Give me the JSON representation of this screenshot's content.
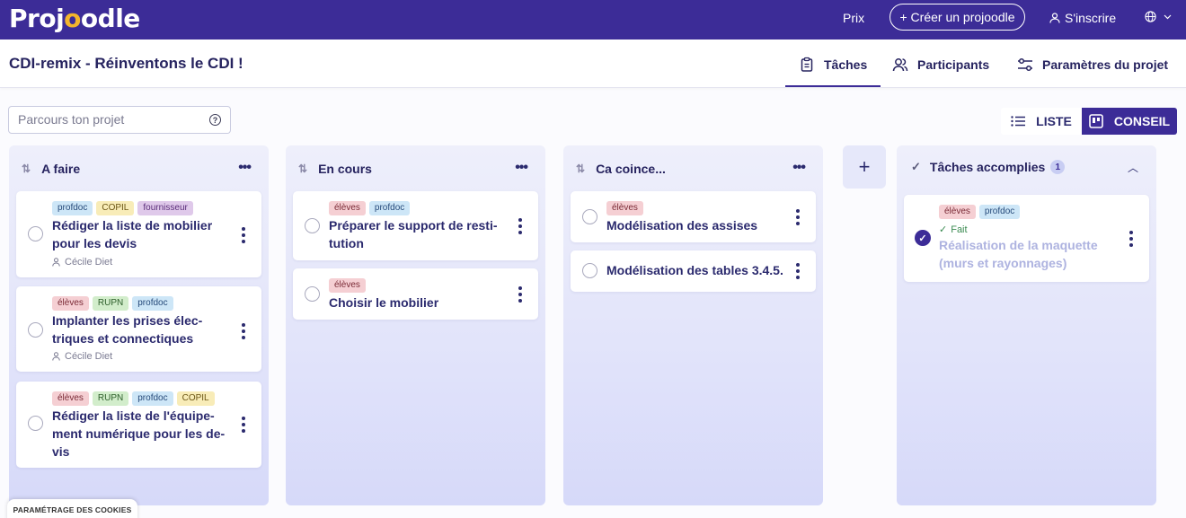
{
  "topbar": {
    "logo_left": "Proj",
    "logo_o": "o",
    "logo_right": "odle",
    "prix": "Prix",
    "create": "+ Créer un projoodle",
    "signin": "S'inscrire",
    "lang_icon": "globe-icon"
  },
  "project": {
    "title": "CDI-remix - Réinventons le CDI !",
    "tabs": [
      {
        "label": "Tâches",
        "icon": "clipboard-icon"
      },
      {
        "label": "Participants",
        "icon": "users-icon"
      },
      {
        "label": "Paramètres du projet",
        "icon": "sliders-icon"
      }
    ]
  },
  "search": {
    "placeholder": "Parcours ton projet"
  },
  "view": {
    "list": "LISTE",
    "board": "CONSEIL"
  },
  "columns": [
    {
      "title": "A faire",
      "cards": [
        {
          "tags": [
            "profdoc",
            "COPIL",
            "fournisseur"
          ],
          "title_lines": [
            "Rédiger la liste de mobilier",
            "pour les devis"
          ],
          "assignee": "Cécile Diet"
        },
        {
          "tags": [
            "élèves",
            "RUPN",
            "profdoc"
          ],
          "title_lines": [
            "Implanter les prises élec-",
            "triques et connectiques"
          ],
          "assignee": "Cécile Diet"
        },
        {
          "tags": [
            "élèves",
            "RUPN",
            "profdoc",
            "COPIL"
          ],
          "title_lines": [
            "Rédiger la liste de l'équipe-",
            "ment numérique pour les de-",
            "vis"
          ]
        }
      ]
    },
    {
      "title": "En cours",
      "cards": [
        {
          "tags": [
            "élèves",
            "profdoc"
          ],
          "title_lines": [
            "Préparer le support de resti-",
            "tution"
          ]
        },
        {
          "tags": [
            "élèves"
          ],
          "title_lines": [
            "Choisir le mobilier"
          ]
        }
      ]
    },
    {
      "title": "Ca coince...",
      "cards": [
        {
          "tags": [
            "élèves"
          ],
          "title_lines": [
            "Modélisation des assises"
          ]
        },
        {
          "title_lines": [
            "Modélisation des tables 3.4.5."
          ]
        }
      ]
    }
  ],
  "add_column": "+",
  "done": {
    "title": "Tâches accomplies",
    "count": "1",
    "card": {
      "tags": [
        "élèves",
        "profdoc"
      ],
      "status": "Fait",
      "title_lines": [
        "Réalisation de la maquette",
        "(murs et rayonnages)"
      ]
    }
  },
  "cookies": "PARAMÉTRAGE DES COOKIES"
}
